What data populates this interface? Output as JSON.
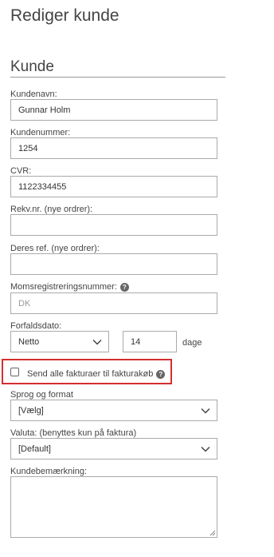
{
  "page": {
    "title": "Rediger kunde"
  },
  "section": {
    "title": "Kunde"
  },
  "fields": {
    "customer_name": {
      "label": "Kundenavn:",
      "value": "Gunnar Holm"
    },
    "customer_number": {
      "label": "Kundenummer:",
      "value": "1254"
    },
    "cvr": {
      "label": "CVR:",
      "value": "1122334455"
    },
    "requisition": {
      "label": "Rekv.nr. (nye ordrer):",
      "value": ""
    },
    "your_ref": {
      "label": "Deres ref. (nye ordrer):",
      "value": ""
    },
    "vat_number": {
      "label": "Momsregistreringsnummer:",
      "placeholder": "DK",
      "help_icon": "question-circle-icon"
    },
    "due_date": {
      "label": "Forfaldsdato:",
      "select_value": "Netto",
      "days_value": "14",
      "days_unit": "dage"
    },
    "send_invoices": {
      "label": "Send alle fakturaer til fakturakøb",
      "checked": false,
      "help_icon": "question-circle-icon"
    },
    "language_format": {
      "label": "Sprog og format",
      "select_value": "[Vælg]"
    },
    "currency": {
      "label": "Valuta: (benyttes kun på faktura)",
      "select_value": "[Default]"
    },
    "customer_note": {
      "label": "Kundebemærkning:",
      "value": ""
    }
  },
  "colors": {
    "highlight_border": "#d32f2f",
    "input_border": "#aaaaaa",
    "help_icon_bg": "#666666"
  }
}
